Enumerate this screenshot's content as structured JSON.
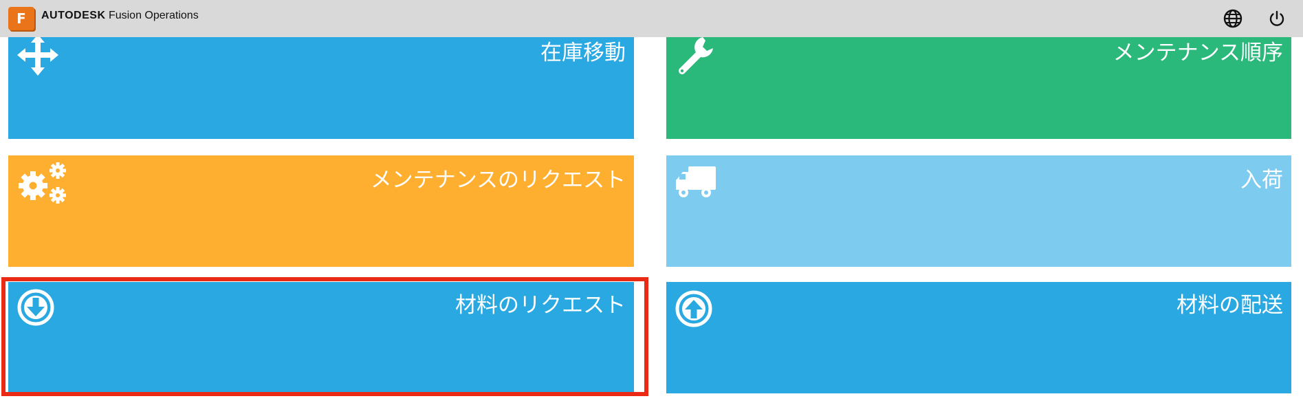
{
  "header": {
    "logo_letter": "F",
    "brand_bold": "AUTODESK",
    "brand_rest": "Fusion Operations",
    "icons": [
      "globe-icon",
      "power-icon"
    ]
  },
  "tiles": [
    {
      "label": "在庫移動",
      "icon": "move-arrows-icon",
      "color": "#29a8e1"
    },
    {
      "label": "メンテナンス順序",
      "icon": "wrench-icon",
      "color": "#2ab87b"
    },
    {
      "label": "メンテナンスのリクエスト",
      "icon": "gears-icon",
      "color": "#ffaf2f"
    },
    {
      "label": "入荷",
      "icon": "truck-icon",
      "color": "#7ecbf0"
    },
    {
      "label": "材料のリクエスト",
      "icon": "arrow-down-circle-icon",
      "color": "#29a8e1",
      "selected": true
    },
    {
      "label": "材料の配送",
      "icon": "arrow-up-circle-icon",
      "color": "#29a8e1"
    }
  ],
  "colors": {
    "header_bg": "#d9d9d9",
    "highlight": "#ea2a15",
    "logo": "#ea7419"
  }
}
